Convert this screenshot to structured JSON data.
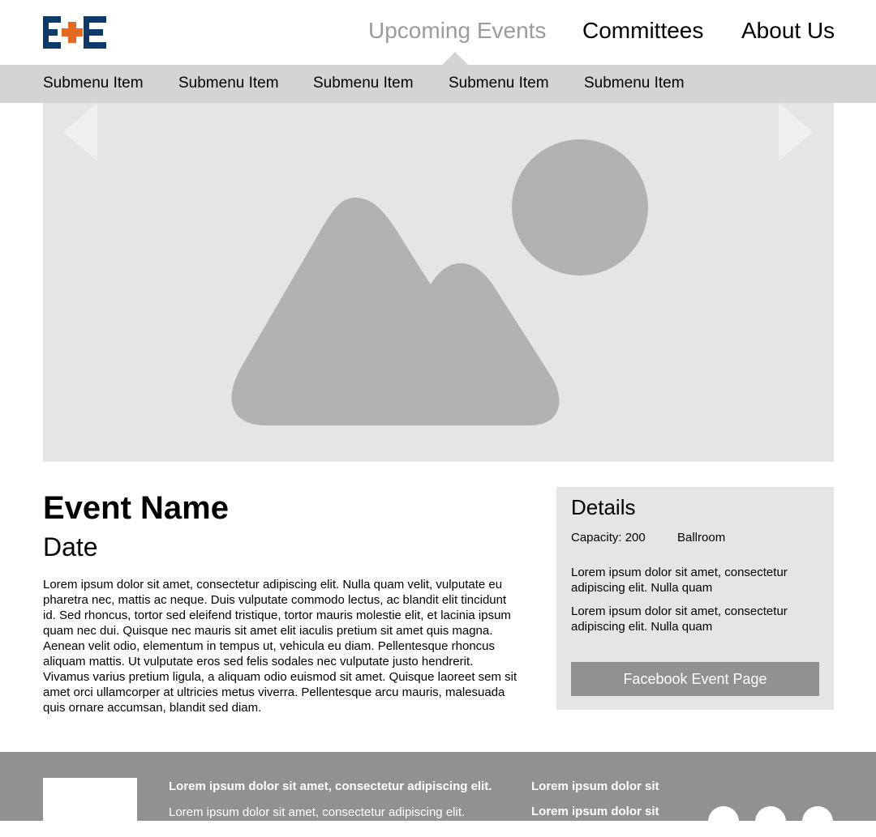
{
  "brand": {
    "logo_text": "E+E",
    "colors": {
      "navy": "#0e3a6b",
      "orange": "#e56a1f"
    }
  },
  "nav": {
    "items": [
      {
        "label": "Upcoming Events",
        "active": true
      },
      {
        "label": "Committees",
        "active": false
      },
      {
        "label": "About Us",
        "active": false
      }
    ]
  },
  "submenu": {
    "items": [
      "Submenu Item",
      "Submenu Item",
      "Submenu Item",
      "Submenu Item",
      "Submenu Item"
    ]
  },
  "carousel": {
    "image": "image-placeholder-icon",
    "prev_icon": "chevron-left-icon",
    "next_icon": "chevron-right-icon"
  },
  "event": {
    "name": "Event Name",
    "date": "Date",
    "description": "Lorem ipsum dolor sit amet, consectetur adipiscing elit. Nulla quam velit, vulputate eu pharetra nec, mattis ac neque. Duis vulputate commodo lectus, ac blandit elit tincidunt id. Sed rhoncus, tortor sed eleifend tristique, tortor mauris molestie elit, et lacinia ipsum quam nec dui. Quisque nec mauris sit amet elit iaculis pretium sit amet quis magna. Aenean velit odio, elementum in tempus ut, vehicula eu diam. Pellentesque rhoncus aliquam mattis. Ut vulputate eros sed felis sodales nec vulputate justo hendrerit. Vivamus varius pretium ligula, a aliquam odio euismod sit amet. Quisque laoreet sem sit amet orci ullamcorper at ultricies metus viverra. Pellentesque arcu mauris, malesuada quis ornare accumsan, blandit sed diam."
  },
  "details": {
    "heading": "Details",
    "capacity": "Capacity: 200",
    "location": "Ballroom",
    "paragraphs": [
      "Lorem ipsum dolor sit amet, consectetur adipiscing elit. Nulla quam",
      "Lorem ipsum dolor sit amet, consectetur adipiscing elit. Nulla quam"
    ],
    "button": "Facebook Event Page"
  },
  "footer": {
    "col1_bold": "Lorem ipsum dolor sit amet, consectetur adipiscing elit.",
    "col1_text": "Lorem ipsum dolor sit amet, consectetur adipiscing elit.",
    "col2_link1": "Lorem ipsum dolor sit",
    "col2_link2": "Lorem ipsum dolor sit",
    "social_icons": [
      "social-icon",
      "social-icon",
      "social-icon"
    ]
  }
}
